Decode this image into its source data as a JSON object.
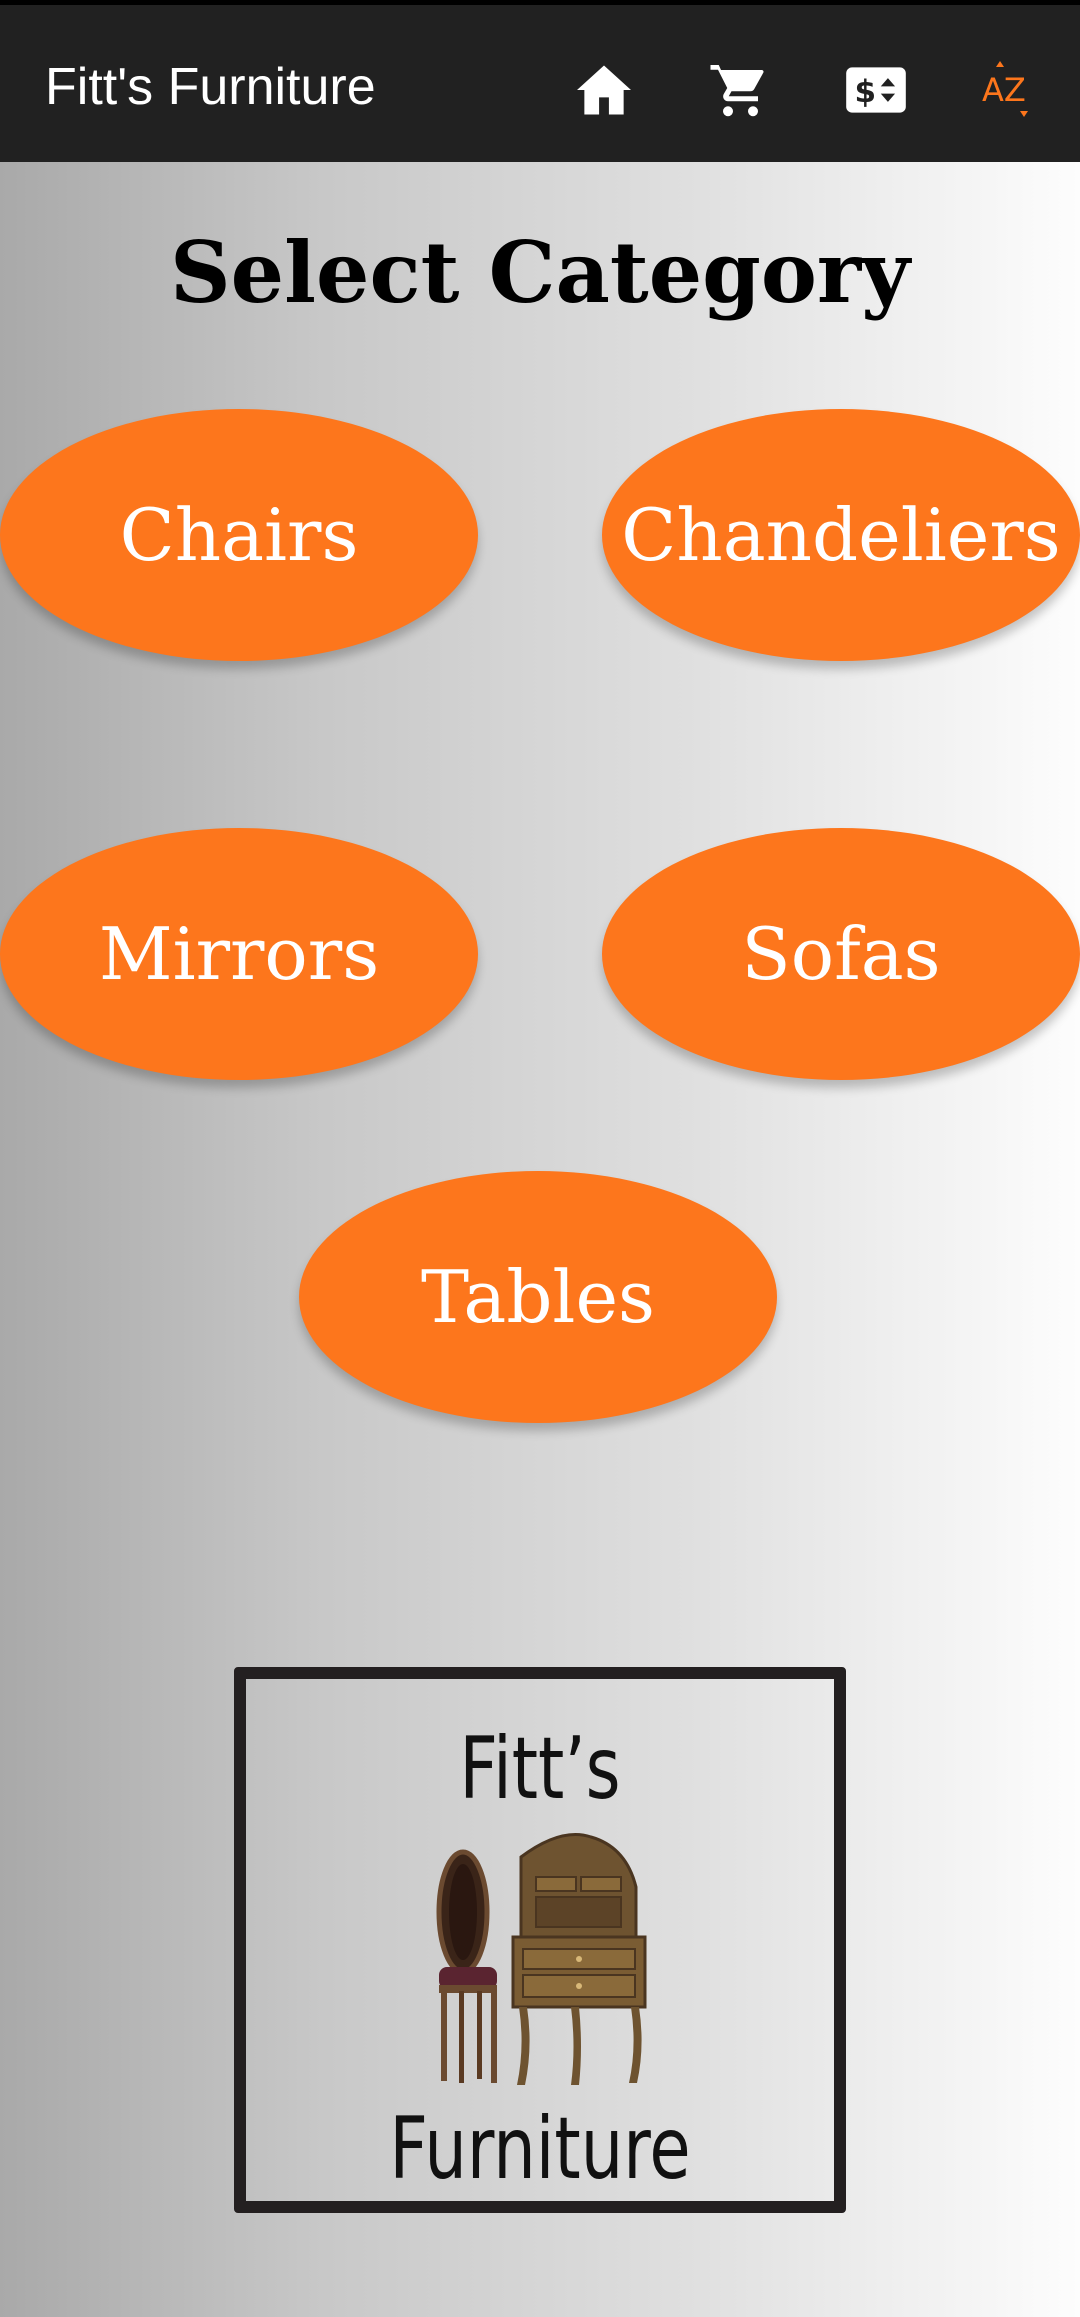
{
  "app_bar": {
    "title": "Fitt's Furniture",
    "background": "#212121",
    "icons": [
      "home-icon",
      "cart-icon",
      "money-icon",
      "sort-az-icon"
    ],
    "sort_label": "AZ",
    "accent": "#fd761c"
  },
  "main": {
    "heading": "Select Category",
    "categories": [
      {
        "label": "Chairs"
      },
      {
        "label": "Chandeliers"
      },
      {
        "label": "Mirrors"
      },
      {
        "label": "Sofas"
      },
      {
        "label": "Tables"
      }
    ],
    "button_color": "#fd761c"
  },
  "logo": {
    "line1": "Fitt’s",
    "line2": "Furniture"
  }
}
